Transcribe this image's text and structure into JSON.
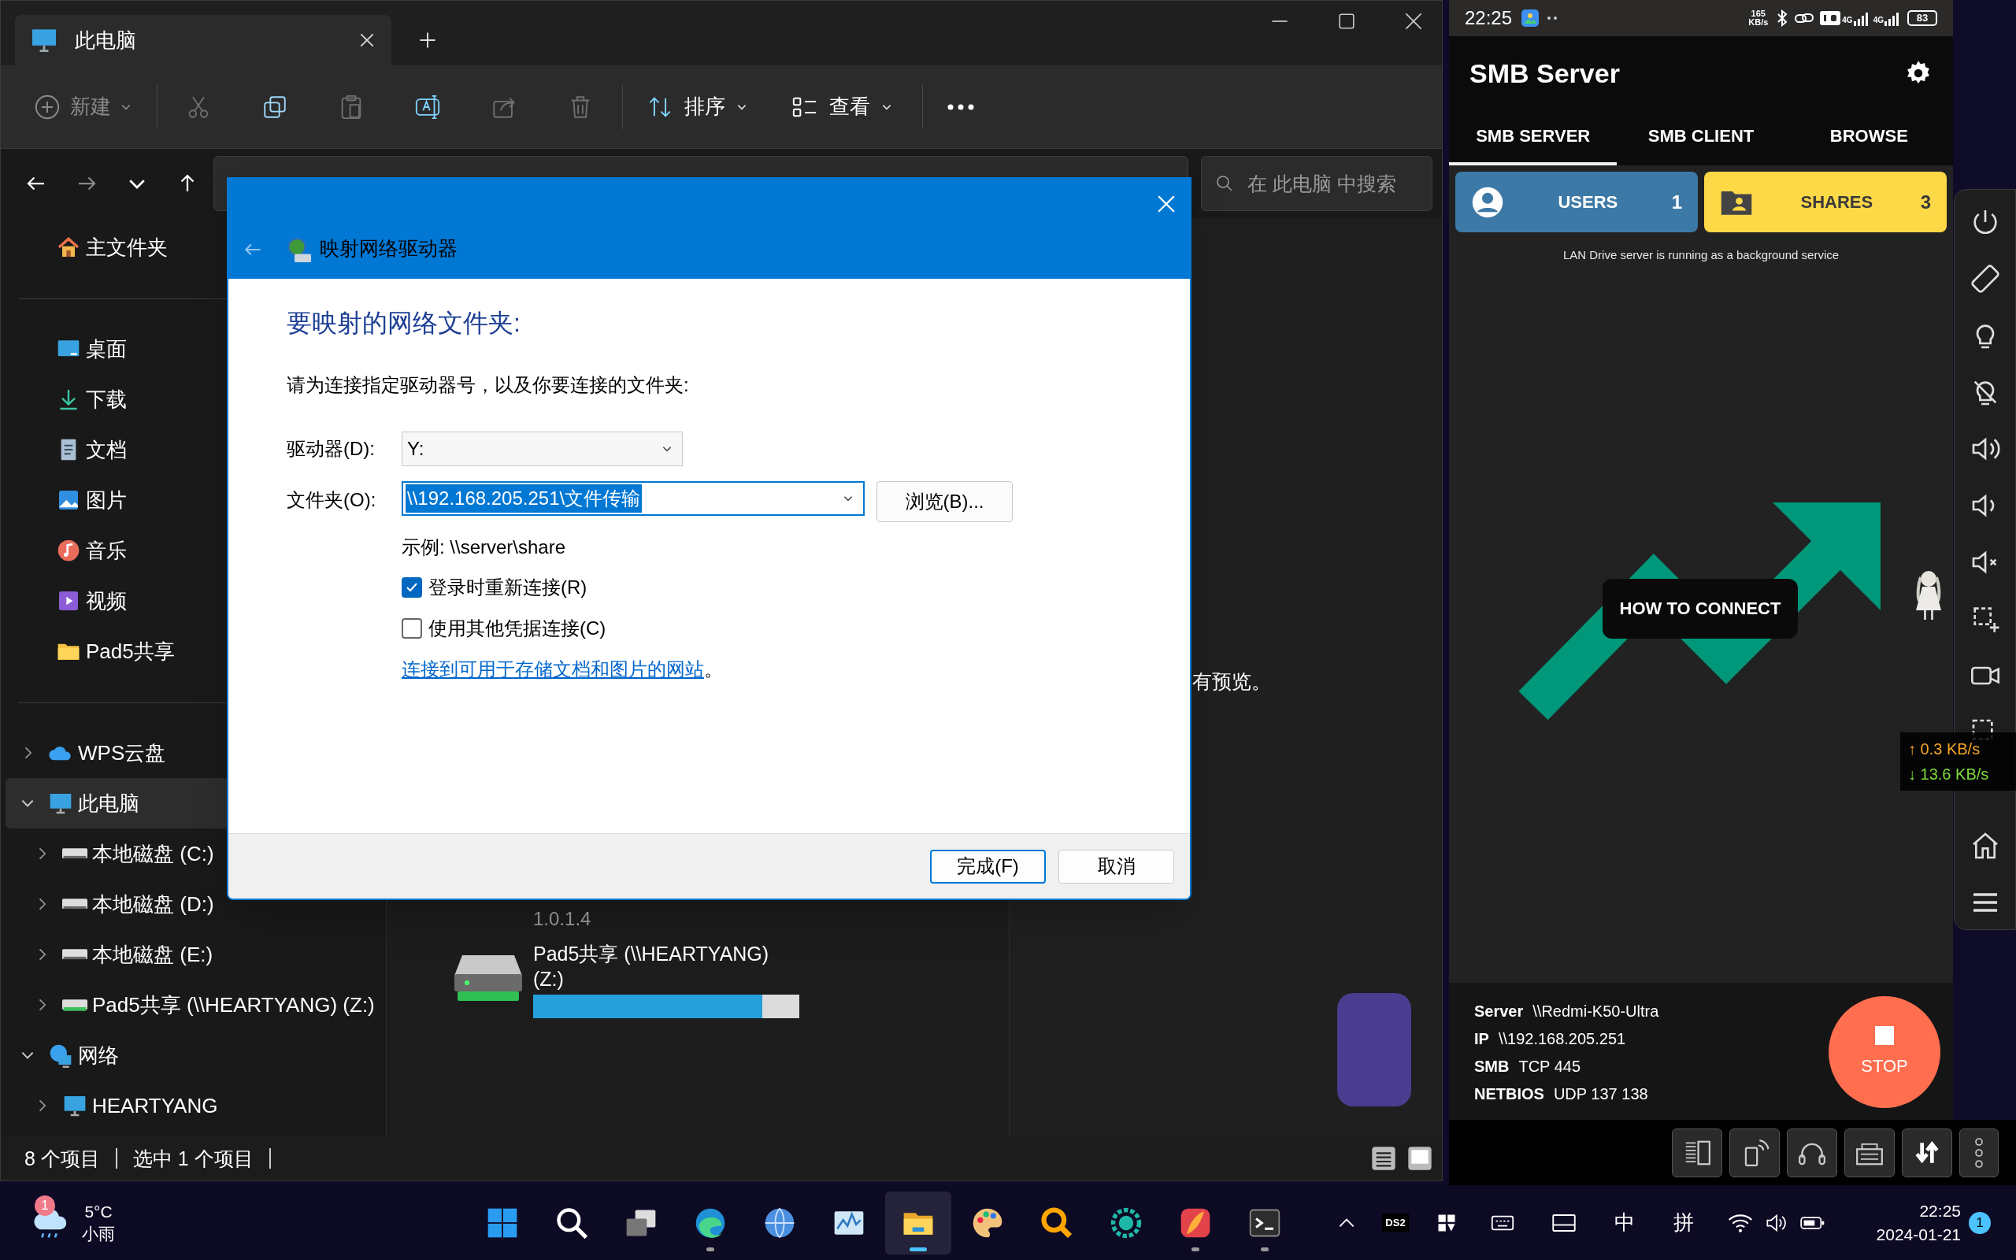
{
  "explorer": {
    "tab_title": "此电脑",
    "toolbar": {
      "new": {
        "label": "新建",
        "disabled": true
      },
      "actions": [
        {
          "kind": "cut",
          "disabled": true
        },
        {
          "kind": "copy",
          "disabled": false
        },
        {
          "kind": "paste",
          "disabled": true
        },
        {
          "kind": "rename",
          "disabled": false
        },
        {
          "kind": "share",
          "disabled": true
        },
        {
          "kind": "delete",
          "disabled": true
        }
      ],
      "sort": "排序",
      "view": "查看"
    },
    "search": {
      "placeholder": "在 此电脑 中搜索"
    },
    "quick_access": [
      {
        "kind": "home",
        "label": "主文件夹",
        "selected": false
      }
    ],
    "pinned": [
      {
        "kind": "desktop",
        "label": "桌面",
        "selected": false
      },
      {
        "kind": "download",
        "label": "下载",
        "selected": false
      },
      {
        "kind": "documents",
        "label": "文档",
        "selected": false
      },
      {
        "kind": "pictures",
        "label": "图片",
        "selected": false
      },
      {
        "kind": "music",
        "label": "音乐",
        "selected": false
      },
      {
        "kind": "videos",
        "label": "视频",
        "selected": false
      },
      {
        "kind": "folder",
        "label": "Pad5共享",
        "selected": false
      }
    ],
    "tree": [
      {
        "kind": "cloud",
        "label": "WPS云盘",
        "expanded": false,
        "selected": false
      },
      {
        "kind": "pc",
        "label": "此电脑",
        "expanded": true,
        "selected": true,
        "children": [
          {
            "kind": "drive",
            "label": "本地磁盘 (C:)",
            "expanded": false,
            "selected": false
          },
          {
            "kind": "drive",
            "label": "本地磁盘 (D:)",
            "expanded": false,
            "selected": false
          },
          {
            "kind": "drive",
            "label": "本地磁盘 (E:)",
            "expanded": false,
            "selected": false
          },
          {
            "kind": "netdrive",
            "label": "Pad5共享 (\\\\HEARTYANG) (Z:)",
            "expanded": false,
            "selected": false
          }
        ]
      },
      {
        "kind": "network",
        "label": "网络",
        "expanded": true,
        "selected": false,
        "children": [
          {
            "kind": "pc",
            "label": "HEARTYANG",
            "expanded": false,
            "selected": false
          }
        ]
      }
    ],
    "content": {
      "partial_text": "1.0.1.4",
      "drive": {
        "name": "Pad5共享 (\\\\HEARTYANG) (Z:)",
        "level": 0.86
      },
      "preview_text": "有预览。"
    },
    "status": {
      "count": "8 个项目",
      "selection": "选中 1 个项目"
    }
  },
  "dialog": {
    "title": "映射网络驱动器",
    "heading": "要映射的网络文件夹:",
    "instruction": "请为连接指定驱动器号，以及你要连接的文件夹:",
    "drive": {
      "label": "驱动器(D):",
      "value": "Y:"
    },
    "folder": {
      "label": "文件夹(O):",
      "value": "\\\\192.168.205.251\\文件传输",
      "text_selected": true
    },
    "browse": "浏览(B)...",
    "example": "示例: \\\\server\\share",
    "options": [
      {
        "label": "登录时重新连接(R)",
        "checked": true
      },
      {
        "label": "使用其他凭据连接(C)",
        "checked": false
      }
    ],
    "link": "连接到可用于存储文档和图片的网站",
    "link_end": "。",
    "finish": {
      "label": "完成(F)",
      "default": true
    },
    "cancel": {
      "label": "取消",
      "default": false
    }
  },
  "phone": {
    "status": {
      "time": "22:25",
      "net_speed": "165",
      "net_unit": "KB/s",
      "network_1": "4G",
      "network_2": "4G",
      "battery": "83"
    },
    "app_title": "SMB Server",
    "tabs": [
      {
        "label": "SMB SERVER",
        "selected": true
      },
      {
        "label": "SMB CLIENT",
        "selected": false
      },
      {
        "label": "BROWSE",
        "selected": false
      }
    ],
    "cards": [
      {
        "kind": "users",
        "label": "USERS",
        "count": "1"
      },
      {
        "kind": "shares",
        "label": "SHARES",
        "count": "3"
      }
    ],
    "service_note": "LAN Drive server is running as a background service",
    "how_to": "HOW TO CONNECT",
    "info": [
      {
        "key": "Server",
        "value": "\\\\Redmi-K50-Ultra"
      },
      {
        "key": "IP",
        "value": "\\\\192.168.205.251"
      },
      {
        "key": "SMB",
        "value": "TCP 445"
      },
      {
        "key": "NETBIOS",
        "value": "UDP 137 138"
      }
    ],
    "stop": "STOP"
  },
  "speed_overlay": {
    "upload": "↑ 0.3 KB/s",
    "download": "↓ 13.6 KB/s"
  },
  "taskbar": {
    "weather": {
      "badge": "1",
      "temp": "5°C",
      "condition": "小雨"
    },
    "apps": [
      {
        "kind": "start",
        "running": false,
        "selected": false
      },
      {
        "kind": "search",
        "running": false,
        "selected": false
      },
      {
        "kind": "taskview",
        "running": false,
        "selected": false
      },
      {
        "kind": "swirl",
        "running": true,
        "selected": false
      },
      {
        "kind": "globe",
        "running": false,
        "selected": false
      },
      {
        "kind": "chart",
        "running": false,
        "selected": false
      },
      {
        "kind": "folder",
        "running": true,
        "selected": true
      },
      {
        "kind": "palette",
        "running": false,
        "selected": false
      },
      {
        "kind": "magnifier",
        "running": false,
        "selected": false
      },
      {
        "kind": "ring",
        "running": false,
        "selected": false
      },
      {
        "kind": "gradient",
        "running": true,
        "selected": false
      },
      {
        "kind": "terminal",
        "running": true,
        "selected": false
      }
    ],
    "tray": {
      "ime_tag": "DS2",
      "ime_mode": "中",
      "ime_layout": "拼",
      "time": "22:25",
      "date": "2024-01-21",
      "notifications": "1"
    }
  }
}
